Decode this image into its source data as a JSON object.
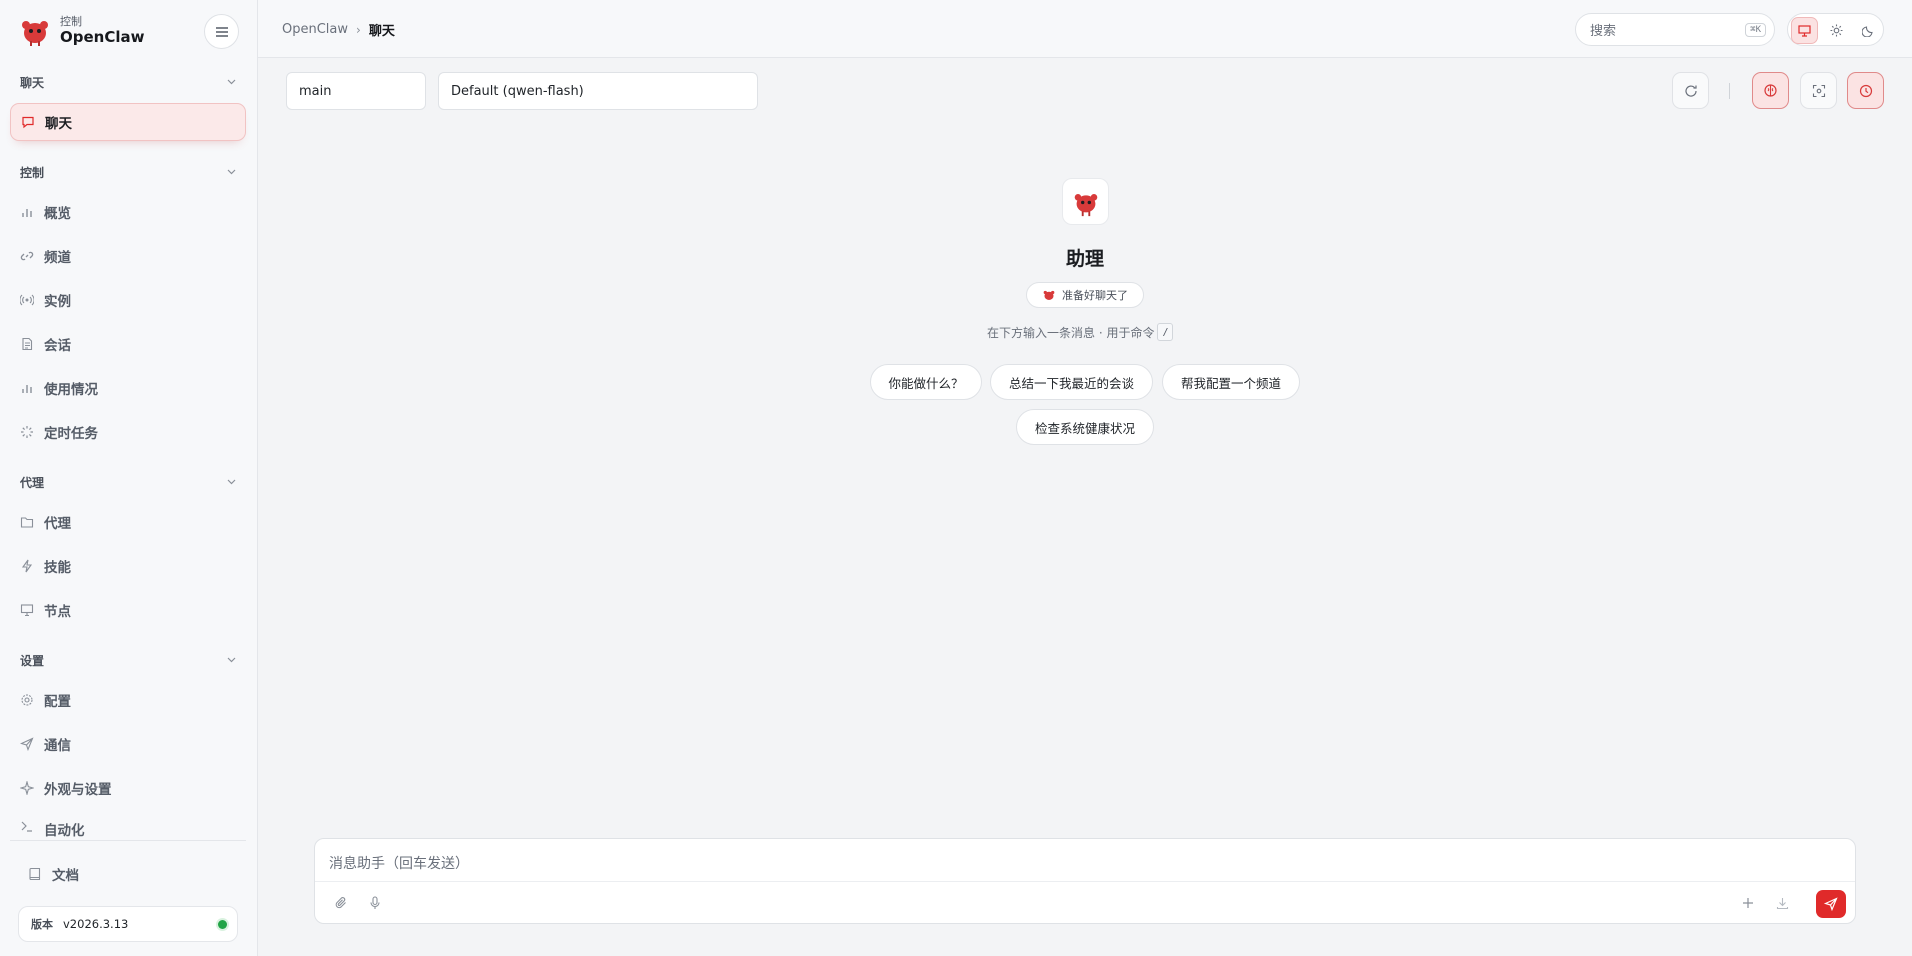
{
  "brand": {
    "subtitle": "控制",
    "name": "OpenClaw"
  },
  "sidebar": {
    "sections": [
      {
        "title": "聊天"
      },
      {
        "title": "控制"
      },
      {
        "title": "代理"
      },
      {
        "title": "设置"
      }
    ],
    "items": [
      {
        "label": "聊天",
        "icon": "chat-bubble-icon"
      },
      {
        "label": "概览",
        "icon": "bar-chart-icon"
      },
      {
        "label": "频道",
        "icon": "link-icon"
      },
      {
        "label": "实例",
        "icon": "radio-signal-icon"
      },
      {
        "label": "会话",
        "icon": "document-icon"
      },
      {
        "label": "使用情况",
        "icon": "bar-chart-icon"
      },
      {
        "label": "定时任务",
        "icon": "loader-icon"
      },
      {
        "label": "代理",
        "icon": "folder-icon"
      },
      {
        "label": "技能",
        "icon": "lightning-icon"
      },
      {
        "label": "节点",
        "icon": "monitor-icon"
      },
      {
        "label": "配置",
        "icon": "gear-icon"
      },
      {
        "label": "通信",
        "icon": "send-icon"
      },
      {
        "label": "外观与设置",
        "icon": "sparkle-icon"
      },
      {
        "label": "自动化",
        "icon": "terminal-icon"
      }
    ],
    "docs": {
      "label": "文档",
      "icon": "book-icon"
    },
    "version": {
      "label": "版本",
      "value": "v2026.3.13",
      "status_color": "#22a447"
    }
  },
  "header": {
    "breadcrumb": {
      "root": "OpenClaw",
      "separator": "›",
      "current": "聊天"
    },
    "search": {
      "placeholder": "搜索",
      "shortcut": "⌘K"
    }
  },
  "chat": {
    "session": "main",
    "model": "Default (qwen-flash)",
    "welcome": {
      "title": "助理",
      "badge": "准备好聊天了",
      "hint": "在下方输入一条消息 · 用于命令",
      "hint_key": "/"
    },
    "suggestions": [
      "你能做什么？",
      "总结一下我最近的会谈",
      "帮我配置一个频道",
      "检查系统健康状况"
    ],
    "composer": {
      "placeholder": "消息助手（回车发送）"
    }
  },
  "colors": {
    "accent": "#e02a2a",
    "active_bg": "#fbe9e9"
  }
}
